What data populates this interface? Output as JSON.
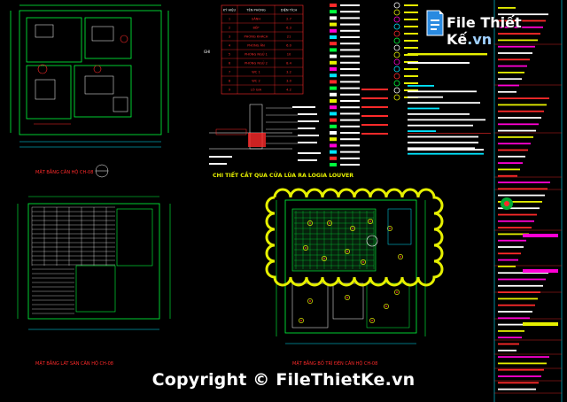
{
  "drawing": {
    "detail_title": "CHI TIẾT CẮT QUA CỬA LÙA RA LOGIA LOUVER",
    "plan_label_1": "MẶT BẰNG CĂN HỘ CH-08",
    "plan_label_2": "MẶT BẰNG LÁT SÀN CĂN HỘ CH-08",
    "plan_label_3": "MẶT BẰNG BỐ TRÍ ĐÈN CĂN HỘ CH-08",
    "table_header": [
      "KÝ HIỆU",
      "TÊN PHÒNG",
      "DIỆN TÍCH"
    ],
    "table_rows": [
      [
        "1",
        "SẢNH",
        "2.7"
      ],
      [
        "2",
        "BẾP",
        "6.3"
      ],
      [
        "3",
        "PHÒNG KHÁCH",
        "21"
      ],
      [
        "4",
        "PHÒNG ĂN",
        "6.0"
      ],
      [
        "5",
        "PHÒNG NGỦ 1",
        "10"
      ],
      [
        "6",
        "PHÒNG NGỦ 2",
        "8.4"
      ],
      [
        "7",
        "WC 1",
        "3.2"
      ],
      [
        "8",
        "WC 2",
        "3.0"
      ],
      [
        "9",
        "LÔ GIA",
        "4.2"
      ]
    ]
  },
  "watermark": {
    "text": "Copyright © FileThietKe.vn"
  },
  "logo": {
    "name": "File Thiết Kế",
    "domain": ".vn"
  },
  "colors": {
    "background": "#000000",
    "green": "#00ff3c",
    "yellow": "#e6f000",
    "red": "#ff2a2a",
    "cyan": "#00e5ff",
    "white": "#ffffff",
    "magenta": "#ff00d4"
  }
}
